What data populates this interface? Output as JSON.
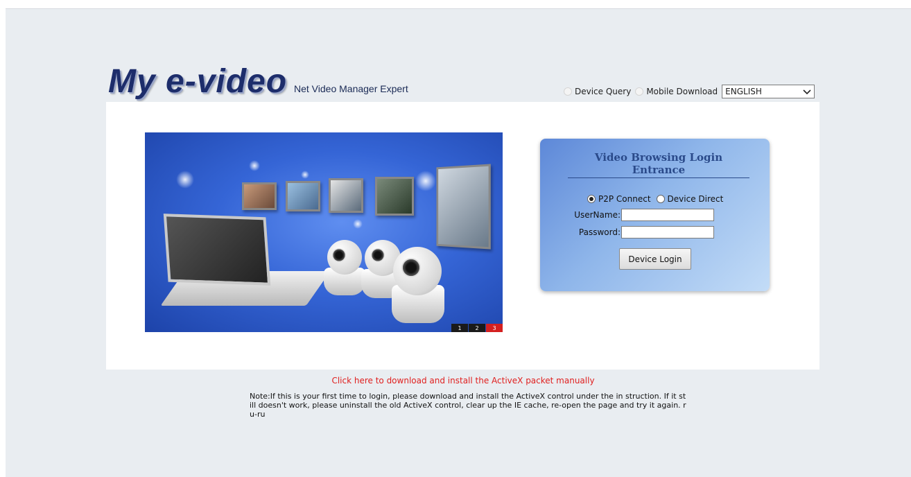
{
  "brand": {
    "logo_text": "My e-video",
    "tagline": "Net Video Manager Expert"
  },
  "top_links": {
    "device_query": "Device Query",
    "mobile_download": "Mobile Download",
    "language": "ENGLISH"
  },
  "banner": {
    "pages": [
      "1",
      "2",
      "3"
    ],
    "active_page": "3"
  },
  "login": {
    "title": "Video Browsing Login Entrance",
    "modes": [
      "P2P Connect",
      "Device Direct"
    ],
    "selected_mode": "P2P Connect",
    "username_label": "UserName:",
    "password_label": "Password:",
    "username_value": "",
    "password_value": "",
    "login_button": "Device Login"
  },
  "footer": {
    "activex_link": "Click here to download and install the ActiveX packet manually",
    "note": "Note:If this is your first time to login, please download and install the ActiveX control under the in struction. If it still doesn't work, please uninstall the old ActiveX control, clear up the IE cache, re-open the page and try it again. ru-ru"
  },
  "colors": {
    "page_background": "#e9edf1",
    "link_red": "#e0201f",
    "brand_navy": "#1d2d6b",
    "login_title": "#2a4a8a",
    "pager_active": "#d42020"
  }
}
